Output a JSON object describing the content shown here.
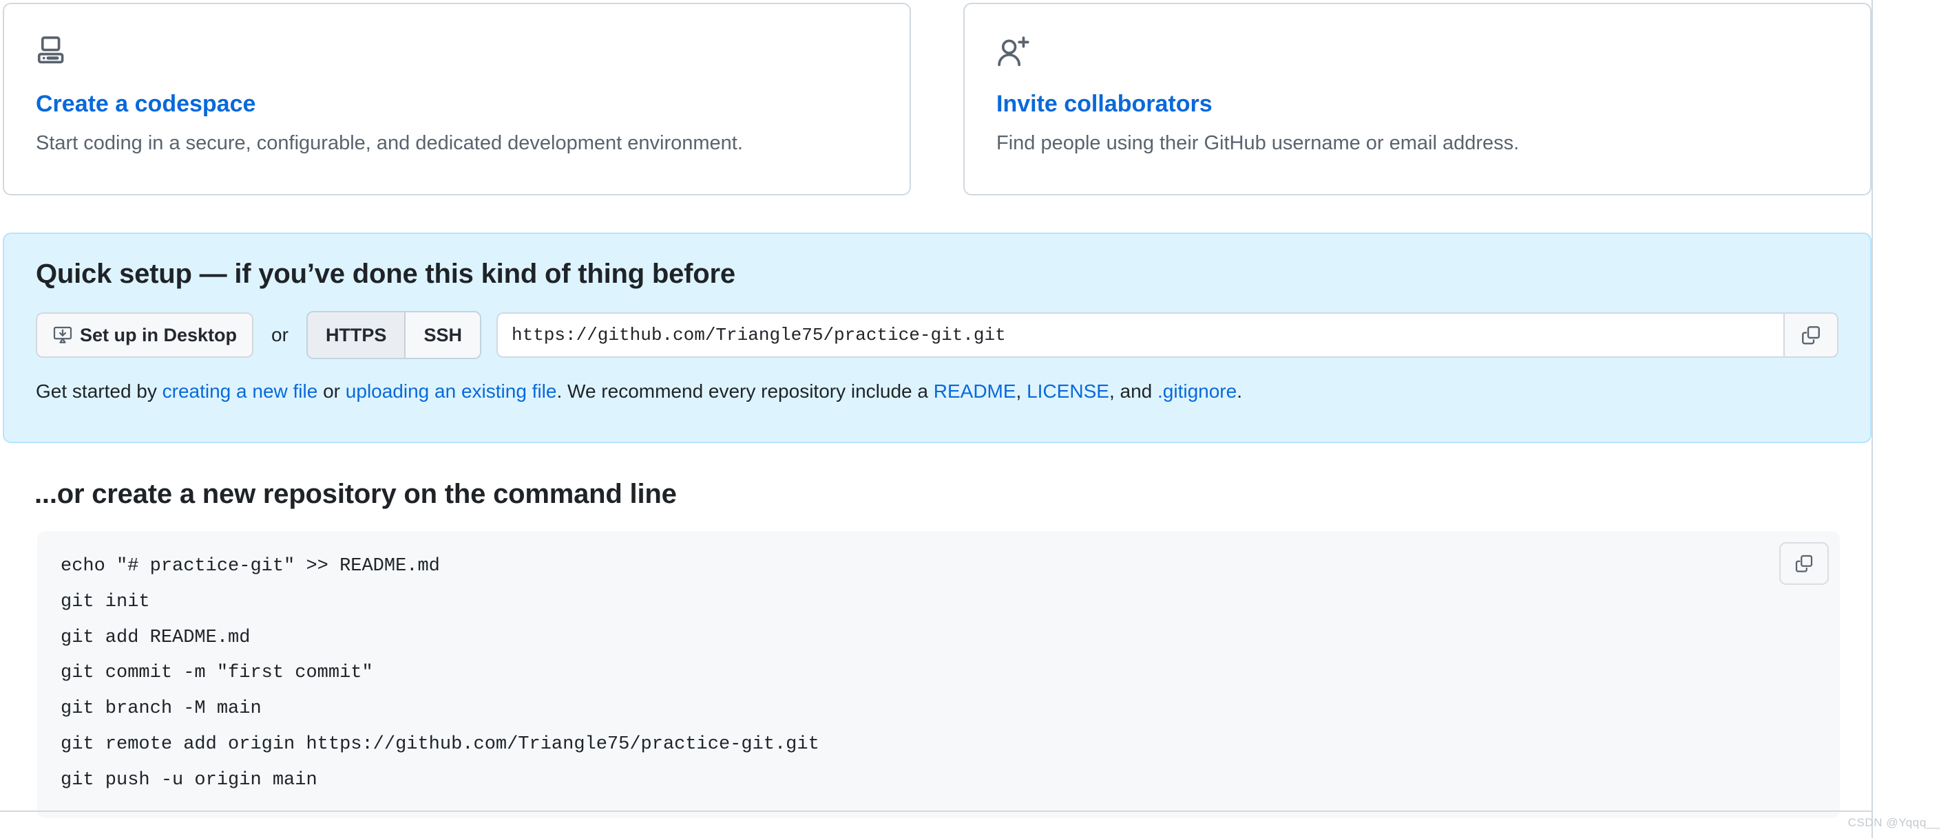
{
  "cards": [
    {
      "icon": "device-desktop-icon",
      "title": "Create a codespace",
      "description": "Start coding in a secure, configurable, and dedicated development environment."
    },
    {
      "icon": "person-add-icon",
      "title": "Invite collaborators",
      "description": "Find people using their GitHub username or email address."
    }
  ],
  "quick_setup": {
    "heading": "Quick setup — if you’ve done this kind of thing before",
    "setup_desktop_label": "Set up in Desktop",
    "or_label": "or",
    "protocols": [
      {
        "label": "HTTPS",
        "selected": true
      },
      {
        "label": "SSH",
        "selected": false
      }
    ],
    "clone_url": "https://github.com/Triangle75/practice-git.git",
    "copy_button_icon": "copy-icon",
    "get_started": {
      "prefix": "Get started by ",
      "link_create": "creating a new file",
      "mid1": " or ",
      "link_upload": "uploading an existing file",
      "mid2": ". We recommend every repository include a ",
      "link_readme": "README",
      "sep1": ", ",
      "link_license": "LICENSE",
      "sep2": ", and ",
      "link_gitignore": ".gitignore",
      "suffix": "."
    }
  },
  "command_line": {
    "heading": "...or create a new repository on the command line",
    "copy_button_icon": "copy-icon",
    "commands": "echo \"# practice-git\" >> README.md\ngit init\ngit add README.md\ngit commit -m \"first commit\"\ngit branch -M main\ngit remote add origin https://github.com/Triangle75/practice-git.git\ngit push -u origin main"
  },
  "watermark": "CSDN @Yqqq__",
  "colors": {
    "link": "#0969da",
    "panel_bg": "#ddf4ff",
    "panel_border": "#b6e3ff",
    "code_bg": "#f6f8fa",
    "muted_text": "#59636e",
    "border": "#d1d9e0"
  }
}
